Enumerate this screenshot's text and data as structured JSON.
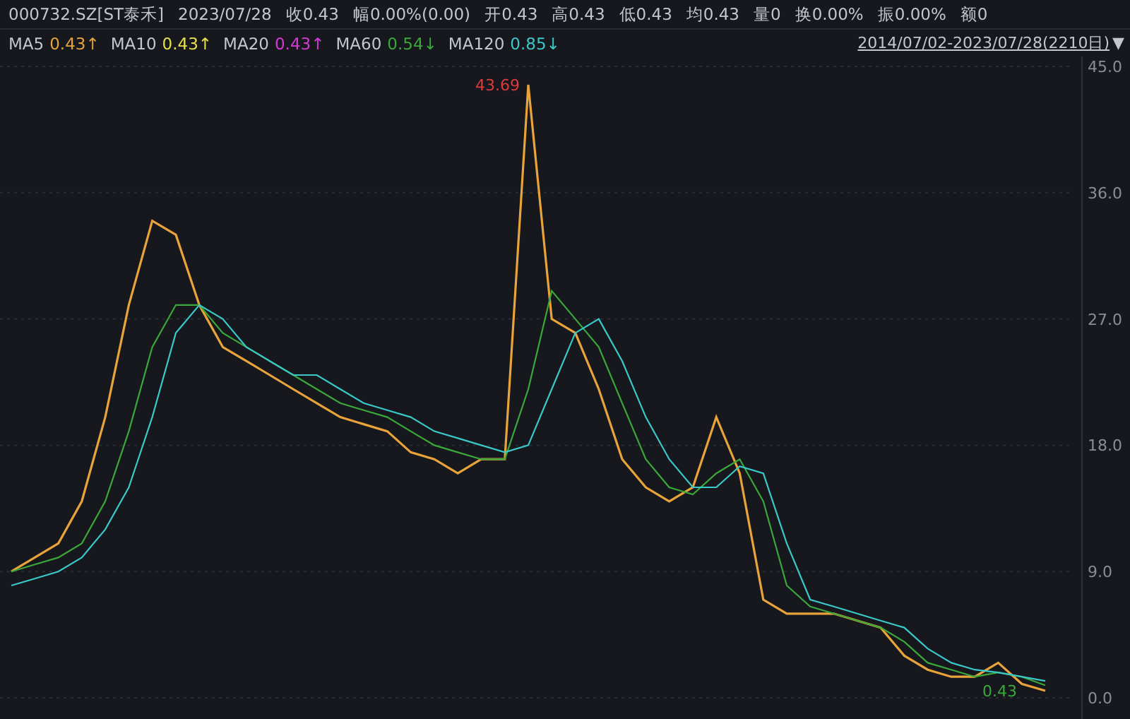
{
  "quote_bar": {
    "symbol": "000732.SZ[ST泰禾]",
    "date": "2023/07/28",
    "fields": [
      {
        "label": "收",
        "value": "0.43"
      },
      {
        "label": "幅",
        "value": "0.00%(0.00)"
      },
      {
        "label": "开",
        "value": "0.43"
      },
      {
        "label": "高",
        "value": "0.43"
      },
      {
        "label": "低",
        "value": "0.43"
      },
      {
        "label": "均",
        "value": "0.43"
      },
      {
        "label": "量",
        "value": "0"
      },
      {
        "label": "换",
        "value": "0.00%"
      },
      {
        "label": "振",
        "value": "0.00%"
      },
      {
        "label": "额",
        "value": "0"
      }
    ]
  },
  "ma_bar": {
    "items": [
      {
        "label": "MA5",
        "value": "0.43↑",
        "color": "#e8a33a"
      },
      {
        "label": "MA10",
        "value": "0.43↑",
        "color": "#e6e04a"
      },
      {
        "label": "MA20",
        "value": "0.43↑",
        "color": "#d63ad6"
      },
      {
        "label": "MA60",
        "value": "0.54↓",
        "color": "#3aa83a"
      },
      {
        "label": "MA120",
        "value": "0.85↓",
        "color": "#3ac8c8"
      }
    ],
    "range": "2014/07/02-2023/07/28(2210日)",
    "range_toggle": "▼"
  },
  "chart": {
    "chart_data": {
      "type": "line",
      "ylim": [
        0,
        45
      ],
      "yticks": [
        {
          "value": 0,
          "label": "0.0"
        },
        {
          "value": 9,
          "label": "9.0"
        },
        {
          "value": 18,
          "label": "18.0"
        },
        {
          "value": 27,
          "label": "27.0"
        },
        {
          "value": 36,
          "label": "36.0"
        },
        {
          "value": 45,
          "label": "45.0"
        }
      ],
      "grid": true,
      "series": [
        {
          "color": "#e8a33a",
          "values": [
            9,
            10,
            11,
            14,
            20,
            28,
            34,
            33,
            28,
            25,
            24,
            23,
            22,
            21,
            20,
            19.5,
            19,
            17.5,
            17,
            16,
            17,
            17,
            43.69,
            27,
            26,
            22,
            17,
            15,
            14,
            15,
            20,
            16,
            7,
            6,
            6,
            6,
            5.5,
            5,
            3,
            2,
            1.5,
            1.5,
            2.5,
            1,
            0.5
          ]
        },
        {
          "color": "#3aa83a",
          "values": [
            9,
            9.5,
            10,
            11,
            14,
            19,
            25,
            28,
            28,
            26,
            25,
            24,
            23,
            22,
            21,
            20.5,
            20,
            19,
            18,
            17.5,
            17,
            17,
            22,
            29,
            27,
            25,
            21,
            17,
            15,
            14.5,
            16,
            17,
            14,
            8,
            6.5,
            6,
            5.5,
            5,
            4,
            2.5,
            2,
            1.5,
            1.8,
            1.5,
            0.9
          ]
        },
        {
          "color": "#3ac8c8",
          "values": [
            8,
            8.5,
            9,
            10,
            12,
            15,
            20,
            26,
            28,
            27,
            25,
            24,
            23,
            23,
            22,
            21,
            20.5,
            20,
            19,
            18.5,
            18,
            17.5,
            18,
            22,
            26,
            27,
            24,
            20,
            17,
            15,
            15,
            16.5,
            16,
            11,
            7,
            6.5,
            6,
            5.5,
            5,
            3.5,
            2.5,
            2,
            1.8,
            1.5,
            1.2
          ]
        }
      ],
      "annotations": [
        "43.69",
        "0.43"
      ]
    }
  }
}
